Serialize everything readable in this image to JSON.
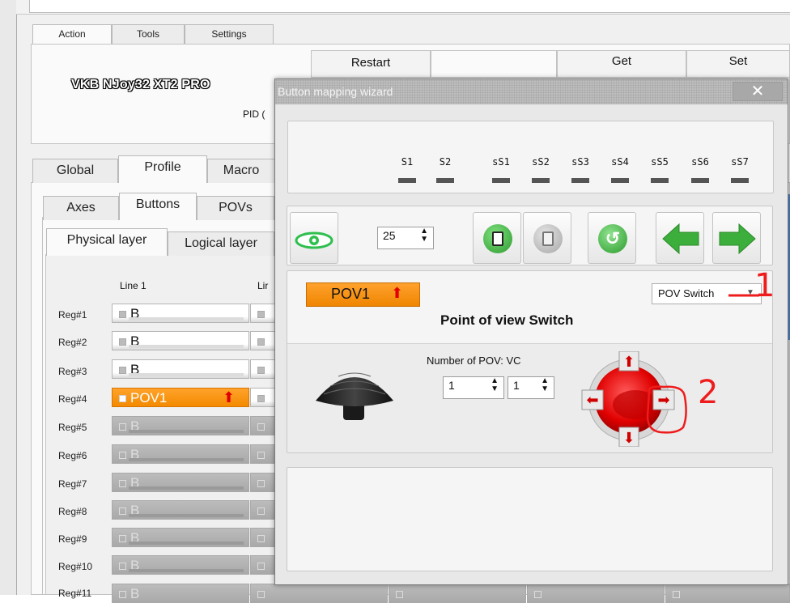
{
  "top_tabs": [
    "Action",
    "Tools",
    "Settings"
  ],
  "toolbar": {
    "restart": "Restart",
    "get": "Get",
    "set": "Set"
  },
  "device": {
    "name": "VKB NJoy32 XT2 PRO",
    "pid": "PID ("
  },
  "profile_tabs": [
    "Global",
    "Profile",
    "Macro"
  ],
  "sub_tabs": [
    "Axes",
    "Buttons",
    "POVs"
  ],
  "layer_tabs": [
    "Physical layer",
    "Logical layer"
  ],
  "grid": {
    "col1_header": "Line 1",
    "col2_header": "Lir",
    "rows": [
      {
        "reg": "Reg#1",
        "label": "B",
        "state": "normal"
      },
      {
        "reg": "Reg#2",
        "label": "B",
        "state": "normal"
      },
      {
        "reg": "Reg#3",
        "label": "B",
        "state": "normal"
      },
      {
        "reg": "Reg#4",
        "label": "POV1",
        "state": "pov"
      },
      {
        "reg": "Reg#5",
        "label": "B",
        "state": "dim"
      },
      {
        "reg": "Reg#6",
        "label": "B",
        "state": "dim"
      },
      {
        "reg": "Reg#7",
        "label": "B",
        "state": "dim"
      },
      {
        "reg": "Reg#8",
        "label": "B",
        "state": "dim"
      },
      {
        "reg": "Reg#9",
        "label": "B",
        "state": "dim"
      },
      {
        "reg": "Reg#10",
        "label": "B",
        "state": "dim"
      },
      {
        "reg": "Reg#11",
        "label": "B",
        "state": "dim"
      }
    ]
  },
  "dialog": {
    "title": "Button mapping wizard",
    "close": "✕",
    "slots": [
      "S1",
      "S2",
      "sS1",
      "sS2",
      "sS3",
      "sS4",
      "sS5",
      "sS6",
      "sS7"
    ],
    "spin_value": "25",
    "pov_badge": "POV1",
    "pov_type": "POV Switch",
    "pov_title": "Point of view Switch",
    "num_pov_label": "Number of POV: VC",
    "num_pov_value1": "1",
    "num_pov_value2": "1"
  },
  "annotations": {
    "mark1": "1",
    "mark2": "2"
  },
  "colors": {
    "pov_orange": "#f39000",
    "green": "#3ca83c",
    "annotation_red": "#ee1c1c"
  },
  "icons": [
    "eye-icon",
    "copy-icon",
    "paste-icon",
    "reset-icon",
    "arrow-left-icon",
    "arrow-right-icon",
    "joystick-hat-icon",
    "pov-direction-pad-icon"
  ]
}
